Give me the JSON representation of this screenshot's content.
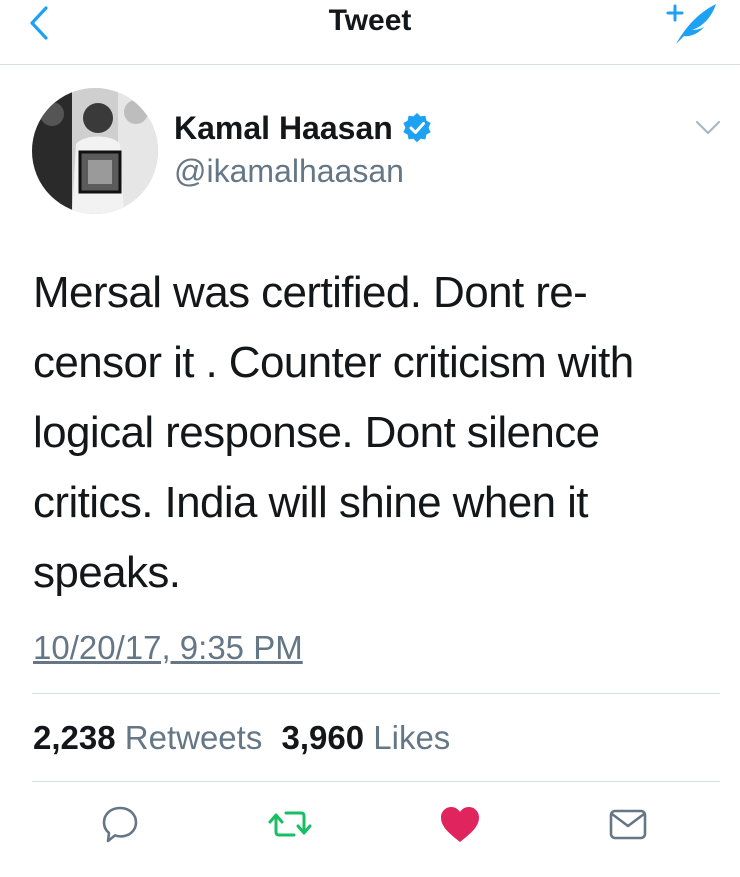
{
  "nav": {
    "title": "Tweet",
    "back_icon": "chevron-left-icon",
    "compose_icon": "compose-tweet-icon",
    "accent_color": "#1da1f2"
  },
  "author": {
    "name": "Kamal Haasan",
    "handle": "@ikamalhaasan",
    "verified_icon": "verified-badge-icon"
  },
  "tweet": {
    "text_lines": [
      "Mersal was certified. Dont re-",
      "censor it . Counter criticism with",
      "logical response. Dont silence",
      "critics. India will shine when it",
      "speaks."
    ],
    "timestamp": "10/20/17, 9:35 PM"
  },
  "stats": {
    "retweets_count": "2,238",
    "retweets_label": "Retweets",
    "likes_count": "3,960",
    "likes_label": "Likes"
  },
  "actions": {
    "reply_icon": "reply-icon",
    "retweet_icon": "retweet-icon",
    "like_icon": "heart-icon",
    "message_icon": "envelope-icon",
    "retweet_color": "#17bf63",
    "like_color": "#e0245e"
  }
}
